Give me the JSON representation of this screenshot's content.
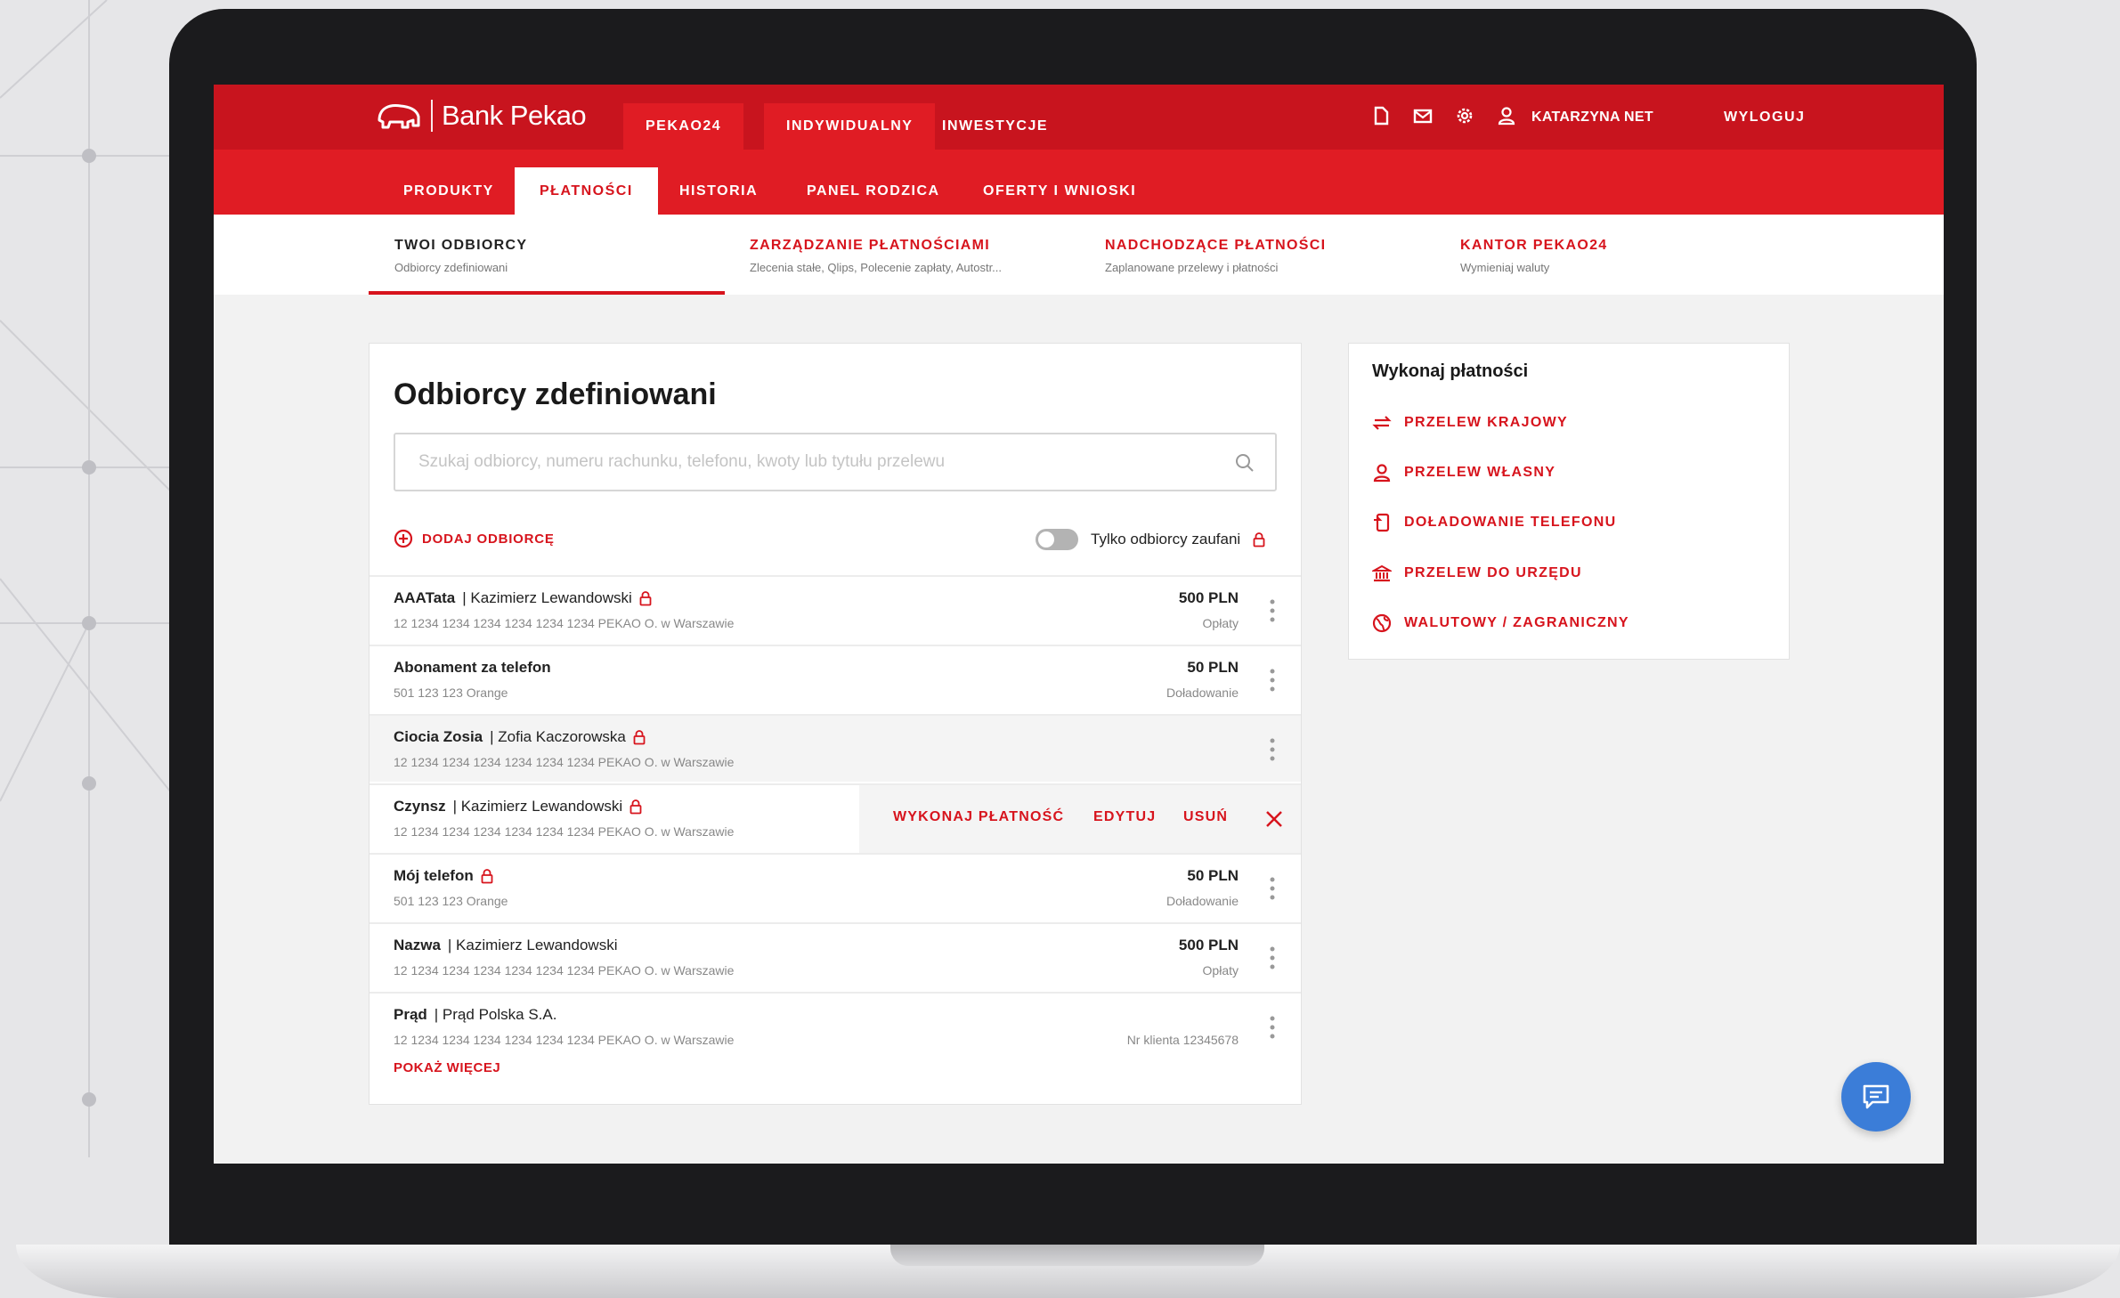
{
  "brand": {
    "name": "Bank Pekao"
  },
  "top_nav": {
    "tabs": [
      {
        "label": "PEKAO24"
      },
      {
        "label": "INDYWIDUALNY"
      },
      {
        "label": "INWESTYCJE"
      }
    ],
    "icons": [
      "document-icon",
      "mail-icon",
      "gear-icon",
      "user-icon"
    ],
    "user_name": "KATARZYNA NET",
    "logout_label": "WYLOGUJ"
  },
  "sub_nav": {
    "tabs": [
      {
        "label": "PRODUKTY"
      },
      {
        "label": "PŁATNOŚCI"
      },
      {
        "label": "HISTORIA"
      },
      {
        "label": "PANEL RODZICA"
      },
      {
        "label": "OFERTY I WNIOSKI"
      }
    ],
    "active": "PŁATNOŚCI"
  },
  "section_nav": [
    {
      "title": "TWOI ODBIORCY",
      "subtitle": "Odbiorcy zdefiniowani"
    },
    {
      "title": "ZARZĄDZANIE PŁATNOŚCIAMI",
      "subtitle": "Zlecenia stałe, Qlips, Polecenie zapłaty, Autostr..."
    },
    {
      "title": "NADCHODZĄCE PŁATNOŚCI",
      "subtitle": "Zaplanowane przelewy i płatności"
    },
    {
      "title": "KANTOR PEKAO24",
      "subtitle": "Wymieniaj waluty"
    }
  ],
  "recipients": {
    "title": "Odbiorcy zdefiniowani",
    "search_placeholder": "Szukaj odbiorcy, numeru rachunku, telefonu, kwoty lub tytułu przelewu",
    "add_label": "DODAJ ODBIORCĘ",
    "trusted_toggle_label": "Tylko odbiorcy zaufani",
    "trusted_toggle_on": false,
    "rows": [
      {
        "name": "AAATata",
        "person": "| Kazimierz Lewandowski",
        "sub": "12 1234 1234 1234 1234 1234 1234 PEKAO O. w Warszawie",
        "amount": "500 PLN",
        "amount_sub": "Opłaty",
        "trusted": true
      },
      {
        "name": "Abonament za telefon",
        "person": "",
        "sub": "501 123 123 Orange",
        "amount": "50 PLN",
        "amount_sub": "Doładowanie",
        "trusted": false
      },
      {
        "name": "Ciocia Zosia",
        "person": "| Zofia Kaczorowska",
        "sub": "12 1234 1234 1234 1234 1234 1234 PEKAO O. w Warszawie",
        "amount": "",
        "amount_sub": "",
        "trusted": true
      },
      {
        "name": "Czynsz",
        "person": "| Kazimierz Lewandowski",
        "sub": "12 1234 1234 1234 1234 1234 1234 PEKAO O. w Warszawie",
        "amount": "",
        "amount_sub": "",
        "trusted": true
      },
      {
        "name": "Mój telefon",
        "person": "",
        "sub": "501 123 123 Orange",
        "amount": "50 PLN",
        "amount_sub": "Doładowanie",
        "trusted": true
      },
      {
        "name": "Nazwa",
        "person": "| Kazimierz Lewandowski",
        "sub": "12 1234 1234 1234 1234 1234 1234 PEKAO O. w Warszawie",
        "amount": "500 PLN",
        "amount_sub": "Opłaty",
        "trusted": false
      },
      {
        "name": "Prąd",
        "person": "| Prąd Polska S.A.",
        "sub": "12 1234 1234 1234 1234 1234 1234 PEKAO O. w Warszawie",
        "amount": "",
        "amount_sub": "Nr klienta 12345678",
        "trusted": false
      }
    ],
    "row_actions": {
      "pay": "WYKONAJ PŁATNOŚĆ",
      "edit": "EDYTUJ",
      "delete": "USUŃ"
    },
    "show_more_label": "POKAŻ WIĘCEJ"
  },
  "quick_payments": {
    "title": "Wykonaj płatności",
    "items": [
      {
        "label": "PRZELEW KRAJOWY",
        "icon": "transfer-arrows-icon"
      },
      {
        "label": "PRZELEW WŁASNY",
        "icon": "user-icon"
      },
      {
        "label": "DOŁADOWANIE TELEFONU",
        "icon": "phone-topup-icon"
      },
      {
        "label": "PRZELEW DO URZĘDU",
        "icon": "bank-building-icon"
      },
      {
        "label": "WALUTOWY / ZAGRANICZNY",
        "icon": "globe-icon"
      }
    ]
  },
  "colors": {
    "primary_red": "#d7141d",
    "dark_red": "#c8141e",
    "chat_blue": "#3b7dd8"
  }
}
